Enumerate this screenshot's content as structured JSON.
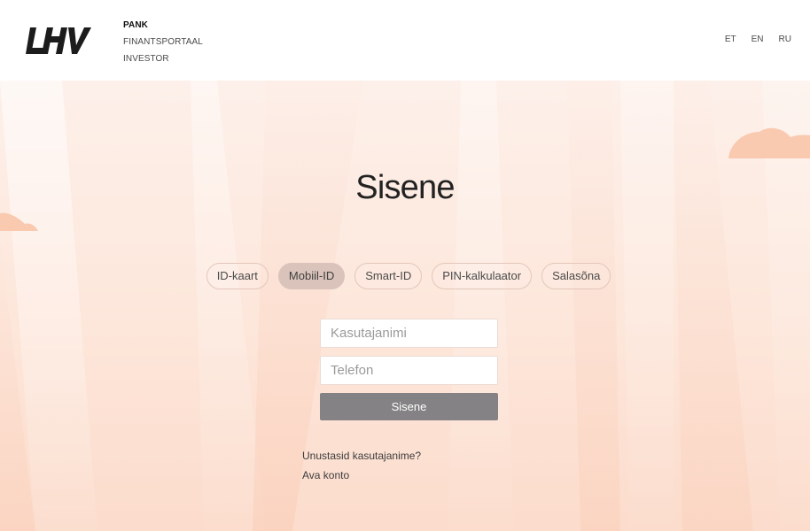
{
  "header": {
    "logo_text": "LHV",
    "nav": [
      {
        "label": "PANK",
        "active": true
      },
      {
        "label": "FINANTSPORTAAL",
        "active": false
      },
      {
        "label": "INVESTOR",
        "active": false
      }
    ],
    "languages": [
      "ET",
      "EN",
      "RU"
    ]
  },
  "login": {
    "title": "Sisene",
    "methods": [
      {
        "label": "ID-kaart",
        "active": false
      },
      {
        "label": "Mobiil-ID",
        "active": true
      },
      {
        "label": "Smart-ID",
        "active": false
      },
      {
        "label": "PIN-kalkulaator",
        "active": false
      },
      {
        "label": "Salasõna",
        "active": false
      }
    ],
    "username_placeholder": "Kasutajanimi",
    "username_value": "",
    "phone_placeholder": "Telefon",
    "phone_value": "",
    "submit_label": "Sisene"
  },
  "help_links": {
    "forgot_username": "Unustasid kasutajanime?",
    "open_account": "Ava konto"
  },
  "colors": {
    "accent_button": "#848284",
    "active_tab": "#d9c3bb",
    "background_peach": "#fde6da",
    "cloud": "#f9c9b0"
  }
}
